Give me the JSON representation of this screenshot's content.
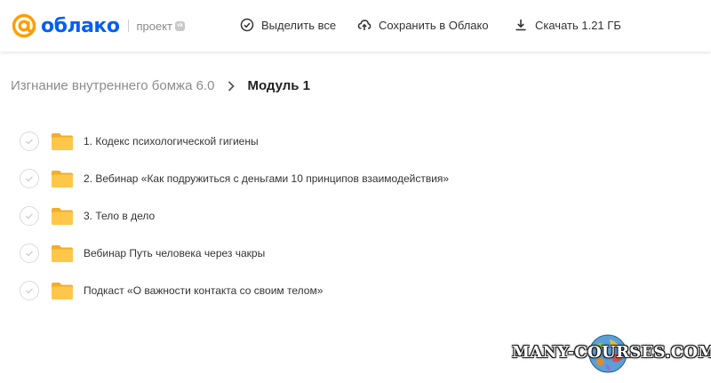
{
  "header": {
    "logo_text": "облако",
    "project_label": "проект",
    "vk_badge": "vk",
    "select_all": "Выделить все",
    "save_to_cloud": "Сохранить в Облако",
    "download": "Скачать 1.21 ГБ"
  },
  "breadcrumb": {
    "parent": "Изгнание внутреннего бомжа 6.0",
    "current": "Модуль 1"
  },
  "items": [
    {
      "label": "1. Кодекс психологической гигиены"
    },
    {
      "label": "2. Вебинар «Как подружиться с деньгами 10 принципов взаимодействия»"
    },
    {
      "label": "3. Тело в дело"
    },
    {
      "label": "Вебинар Путь человека через чакры"
    },
    {
      "label": "Подкаст «О важности контакта со своим телом»"
    }
  ],
  "watermark": {
    "text": "MANY-COURSES.COM"
  },
  "colors": {
    "brand_orange": "#ff9e00",
    "brand_blue": "#005ff9",
    "folder_yellow": "#ffc74a",
    "folder_tab": "#f2ad2a"
  }
}
